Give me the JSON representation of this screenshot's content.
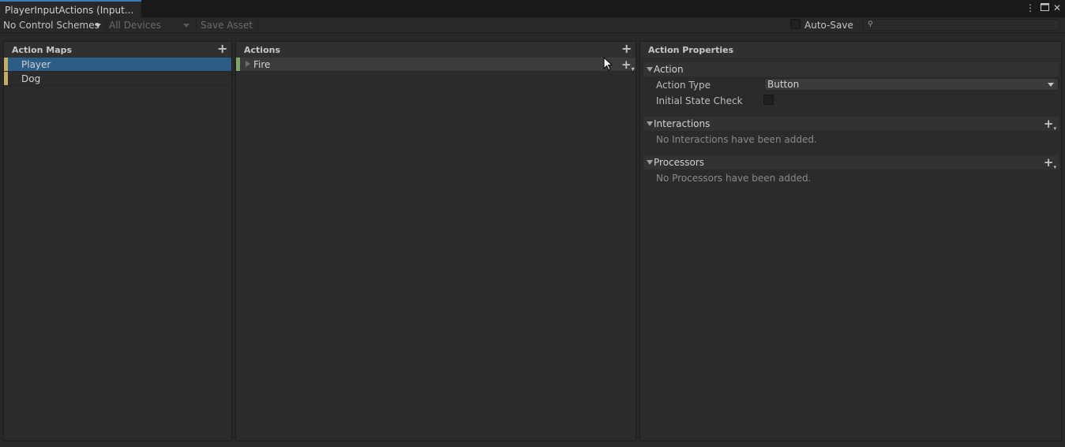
{
  "window": {
    "tab_title": "PlayerInputActions (Input...",
    "menu_icon": "kebab-menu-icon",
    "maximize_icon": "maximize-icon",
    "close_icon": "close-icon"
  },
  "toolbar": {
    "control_schemes": "No Control Schemes",
    "devices": "All Devices",
    "save_asset": "Save Asset",
    "auto_save_label": "Auto-Save",
    "auto_save_checked": false,
    "search_value": ""
  },
  "action_maps": {
    "title": "Action Maps",
    "add_icon": "plus-icon",
    "items": [
      {
        "label": "Player",
        "selected": true
      },
      {
        "label": "Dog",
        "selected": false
      }
    ]
  },
  "actions": {
    "title": "Actions",
    "add_icon": "plus-icon",
    "items": [
      {
        "label": "Fire",
        "selected": true,
        "add_binding_icon": "plus-dropdown-icon"
      }
    ]
  },
  "properties": {
    "title": "Action Properties",
    "action_section": {
      "label": "Action",
      "action_type_label": "Action Type",
      "action_type_value": "Button",
      "initial_state_label": "Initial State Check",
      "initial_state_checked": false
    },
    "interactions_section": {
      "label": "Interactions",
      "empty_text": "No Interactions have been added."
    },
    "processors_section": {
      "label": "Processors",
      "empty_text": "No Processors have been added."
    }
  },
  "colors": {
    "accent": "#3a79bb",
    "selection": "#2c5d87",
    "map_marker": "#c7ad62",
    "action_marker": "#7fa56a"
  }
}
